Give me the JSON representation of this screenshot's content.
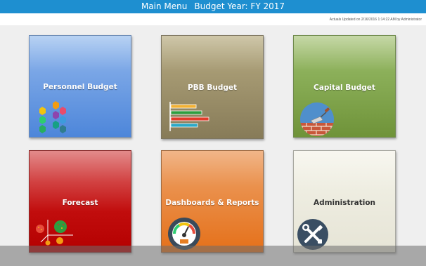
{
  "header": {
    "menu_title": "Main Menu",
    "budget_year": "Budget Year: FY 2017"
  },
  "status": {
    "actuals_updated": "Actuals Updated on 2/16/2016 1:14:22 AM by Administrator"
  },
  "tiles": [
    {
      "label": "Personnel Budget",
      "icon": "hexagon-cluster-icon",
      "color": "#4d86da"
    },
    {
      "label": "PBB Budget",
      "icon": "bar-chart-icon",
      "color": "#877b58"
    },
    {
      "label": "Capital Budget",
      "icon": "trowel-bricks-icon",
      "color": "#6f9339"
    },
    {
      "label": "Forecast",
      "icon": "forecast-scatter-icon",
      "color": "#c10d0d"
    },
    {
      "label": "Dashboards & Reports",
      "icon": "gauge-icon",
      "color": "#e57019"
    },
    {
      "label": "Administration",
      "icon": "wrench-screwdriver-icon",
      "color": "#e6e4d6"
    }
  ],
  "colors": {
    "header_bg": "#1e8fd0",
    "canvas_bg": "#efefef"
  }
}
